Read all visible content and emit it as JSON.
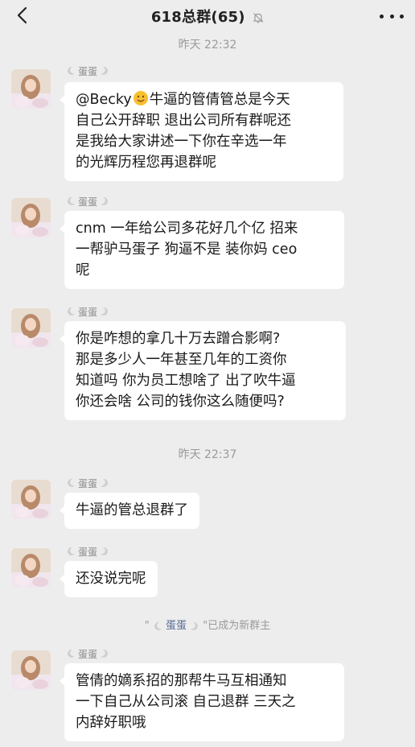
{
  "header": {
    "title": "618总群(65)",
    "back_icon": "chevron-left-icon",
    "mute_icon": "bell-off-icon",
    "more_icon": "more-dots-icon"
  },
  "messages": [
    {
      "time": "昨天 22:32",
      "sender": "蛋蛋",
      "lines_first_prefix": "@Becky",
      "lines_first_suffix": "牛逼的管倩管总是今天",
      "lines": [
        "自己公开辞职 退出公司所有群呢还",
        "是我给大家讲述一下你在辛选一年",
        "的光辉历程您再退群呢"
      ]
    },
    {
      "sender": "蛋蛋",
      "lines": [
        "cnm 一年给公司多花好几个亿 招来",
        "一帮驴马蛋子 狗逼不是 装你妈 ceo",
        "呢"
      ]
    },
    {
      "sender": "蛋蛋",
      "lines": [
        "你是咋想的拿几十万去蹭合影啊?",
        "那是多少人一年甚至几年的工资你",
        "知道吗 你为员工想啥了 出了吹牛逼",
        "你还会啥 公司的钱你这么随便吗?"
      ]
    },
    {
      "time": "昨天 22:37",
      "sender": "蛋蛋",
      "lines": [
        "牛逼的管总退群了"
      ]
    },
    {
      "sender": "蛋蛋",
      "lines": [
        "还没说完呢"
      ]
    },
    {
      "sender": "蛋蛋",
      "lines": [
        "管倩的嫡系招的那帮牛马互相通知",
        "一下自己从公司滚 自己退群 三天之",
        "内辞好职哦"
      ]
    }
  ],
  "system_notice": {
    "prefix": "\"",
    "name": "蛋蛋",
    "suffix": "\"已成为新群主"
  },
  "colors": {
    "background": "#ededed",
    "bubble": "#ffffff",
    "link": "#576b95",
    "muted_text": "#9a9a9a"
  }
}
